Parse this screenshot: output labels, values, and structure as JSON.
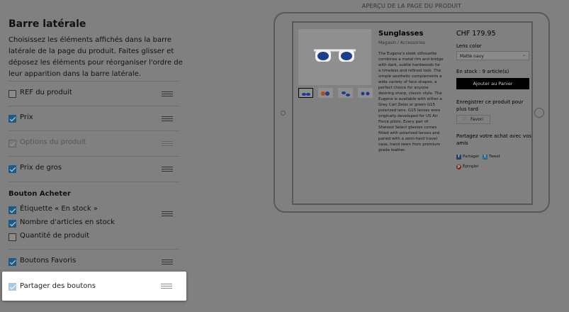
{
  "sidebar": {
    "title": "Barre latérale",
    "description": "Choisissez les éléments affichés dans la barre latérale de la page du produit. Faites glisser et déposez les éléments pour réorganiser l'ordre de leur apparition dans la barre latérale.",
    "items": [
      {
        "label": "REF du produit",
        "checked": false
      },
      {
        "label": "Prix",
        "checked": true
      },
      {
        "label": "Options du produit",
        "checked": true,
        "disabled": true
      },
      {
        "label": "Prix de gros",
        "checked": true
      }
    ],
    "buy_section": {
      "title": "Bouton Acheter",
      "items": [
        {
          "label": "Étiquette « En stock »",
          "checked": true
        },
        {
          "label": "Nombre d'articles en stock",
          "checked": true
        },
        {
          "label": "Quantité de produit",
          "checked": false
        }
      ]
    },
    "favorites": {
      "label": "Boutons Favoris",
      "checked": true
    },
    "share": {
      "label": "Partager des boutons",
      "checked": true
    }
  },
  "preview": {
    "title": "APERÇU DE LA PAGE DU PRODUIT",
    "product_name": "Sunglasses",
    "breadcrumb": "Magasin / Accessories",
    "description": "The Eugene's sleek silhouette combines a metal rim and bridge with dark, subtle hardwoods for a timeless and refined look. The simple aesthetic complements a wide variety of face shapes, a perfect choice for anyone desiring sharp, classic style. The Eugene is available with either a Grey Carl Zeiss or green G15 polarized lens. G15 lenses were originally developed for US Air Force pilots. Every pair of Shwood Select glasses comes fitted with polarized lenses and paired with a semi-hard travel case, hand sewn from premium grade leather.",
    "price": "CHF 179.95",
    "lens_label": "Lens color",
    "lens_value": "Matte navy",
    "stock": "En stock : 9 article(s)",
    "add_to_cart": "Ajouter au Panier",
    "save_text": "Enregistrer ce produit pour plus tard",
    "fav_button": "Favori",
    "share_text": "Partagez votre achat avec vos amis",
    "share_buttons": {
      "facebook": "Partager",
      "twitter": "Tweet",
      "pinterest": "Épingler"
    },
    "colors": {
      "lens": "#1c3c8c",
      "frame": "#f2f2f2",
      "button": "#000000",
      "checkbox": "#1c5a87"
    }
  }
}
